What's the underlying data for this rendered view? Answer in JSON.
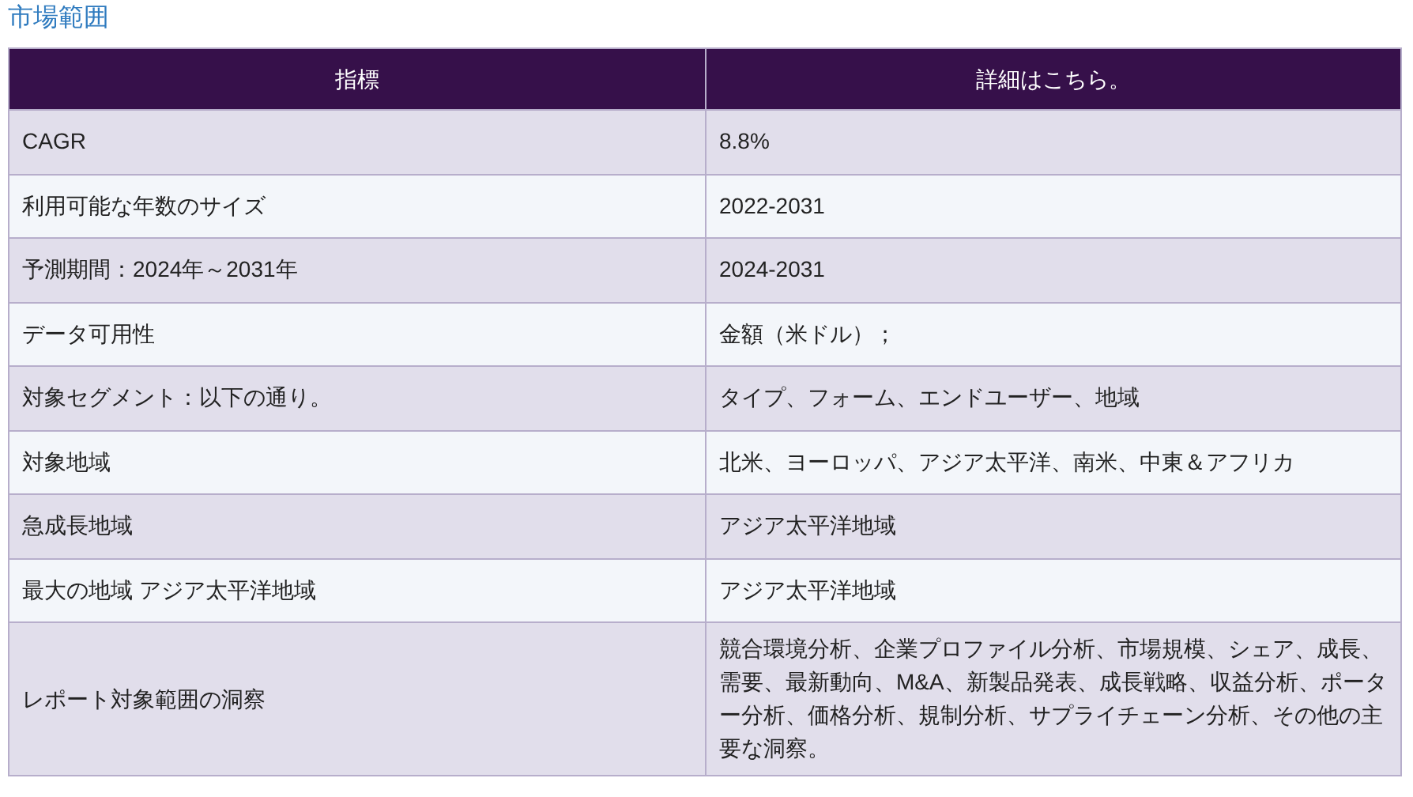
{
  "title": "市場範囲",
  "table": {
    "columns": [
      "指標",
      "詳細はこちら。"
    ],
    "rows": [
      [
        "CAGR",
        "8.8%"
      ],
      [
        "利用可能な年数のサイズ",
        "2022-2031"
      ],
      [
        "予測期間：2024年～2031年",
        "2024-2031"
      ],
      [
        "データ可用性",
        "金額（米ドル）；"
      ],
      [
        "対象セグメント：以下の通り。",
        "タイプ、フォーム、エンドユーザー、地域"
      ],
      [
        "対象地域",
        "北米、ヨーロッパ、アジア太平洋、南米、中東＆アフリカ"
      ],
      [
        "急成長地域",
        "アジア太平洋地域"
      ],
      [
        "最大の地域 アジア太平洋地域",
        "アジア太平洋地域"
      ],
      [
        "レポート対象範囲の洞察",
        "競合環境分析、企業プロファイル分析、市場規模、シェア、成長、需要、最新動向、M&A、新製品発表、成長戦略、収益分析、ポーター分析、価格分析、規制分析、サプライチェーン分析、その他の主要な洞察。"
      ]
    ]
  }
}
